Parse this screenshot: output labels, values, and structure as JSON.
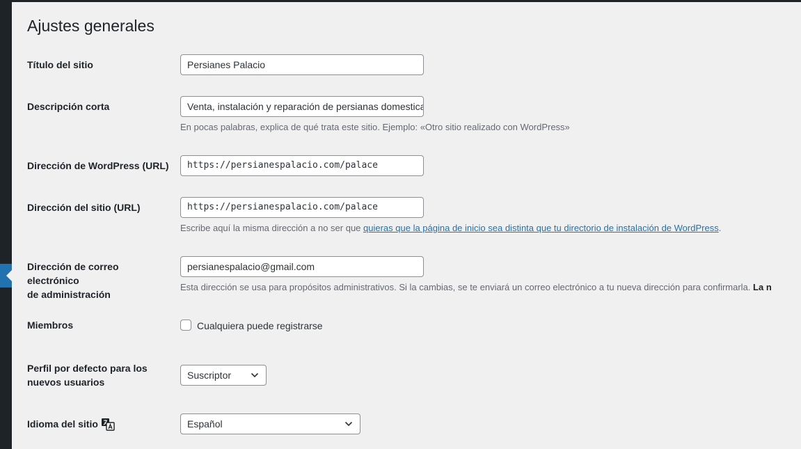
{
  "page": {
    "title": "Ajustes generales"
  },
  "fields": {
    "site_title": {
      "label": "Título del sitio",
      "value": "Persianes Palacio"
    },
    "tagline": {
      "label": "Descripción corta",
      "value": "Venta, instalación y reparación de persianas domesticas",
      "description": "En pocas palabras, explica de qué trata este sitio. Ejemplo: «Otro sitio realizado con WordPress»"
    },
    "wp_url": {
      "label": "Dirección de WordPress (URL)",
      "value": "https://persianespalacio.com/palace"
    },
    "site_url": {
      "label": "Dirección del sitio (URL)",
      "value": "https://persianespalacio.com/palace",
      "description_prefix": "Escribe aquí la misma dirección a no ser que ",
      "description_link": "quieras que la página de inicio sea distinta que tu directorio de instalación de WordPress",
      "description_suffix": "."
    },
    "admin_email": {
      "label_line1": "Dirección de correo electrónico",
      "label_line2": "de administración",
      "value": "persianespalacio@gmail.com",
      "description": "Esta dirección se usa para propósitos administrativos. Si la cambias, se te enviará un correo electrónico a tu nueva dirección para confirmarla.",
      "description_bold": "La n"
    },
    "membership": {
      "label": "Miembros",
      "checkbox_label": "Cualquiera puede registrarse",
      "checked": false
    },
    "default_role": {
      "label_line1": "Perfil por defecto para los",
      "label_line2": "nuevos usuarios",
      "value": "Suscriptor"
    },
    "site_language": {
      "label": "Idioma del sitio",
      "value": "Español"
    }
  },
  "icons": {
    "language": "translation-icon",
    "select_arrow": "chevron-down-icon"
  },
  "colors": {
    "admin_menu": "#1d2327",
    "accent": "#2271b1",
    "background": "#f0f0f1"
  }
}
